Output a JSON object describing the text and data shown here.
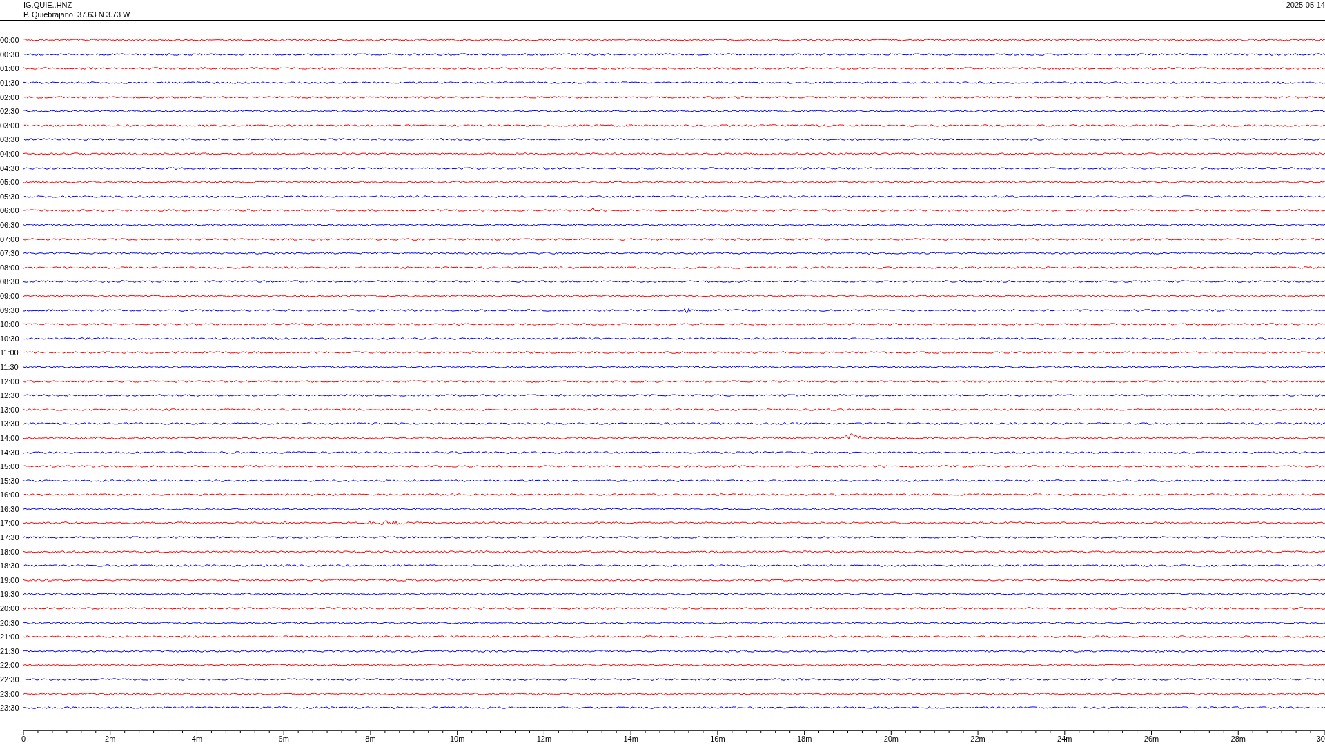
{
  "header": {
    "channel": "IG.QUIE..HNZ",
    "station": "P. Quiebrajano  37.63 N 3.73 W",
    "date": "2025-05-14"
  },
  "rows": [
    {
      "time": "00:00",
      "color": "#ff0000"
    },
    {
      "time": "00:30",
      "color": "#0000ff"
    },
    {
      "time": "01:00",
      "color": "#ff0000"
    },
    {
      "time": "01:30",
      "color": "#0000ff"
    },
    {
      "time": "02:00",
      "color": "#ff0000"
    },
    {
      "time": "02:30",
      "color": "#0000ff"
    },
    {
      "time": "03:00",
      "color": "#ff0000"
    },
    {
      "time": "03:30",
      "color": "#0000ff"
    },
    {
      "time": "04:00",
      "color": "#ff0000"
    },
    {
      "time": "04:30",
      "color": "#0000ff"
    },
    {
      "time": "05:00",
      "color": "#ff0000"
    },
    {
      "time": "05:30",
      "color": "#0000ff"
    },
    {
      "time": "06:00",
      "color": "#ff0000"
    },
    {
      "time": "06:30",
      "color": "#0000ff"
    },
    {
      "time": "07:00",
      "color": "#ff0000"
    },
    {
      "time": "07:30",
      "color": "#0000ff"
    },
    {
      "time": "08:00",
      "color": "#ff0000"
    },
    {
      "time": "08:30",
      "color": "#0000ff"
    },
    {
      "time": "09:00",
      "color": "#ff0000"
    },
    {
      "time": "09:30",
      "color": "#0000ff"
    },
    {
      "time": "10:00",
      "color": "#ff0000"
    },
    {
      "time": "10:30",
      "color": "#0000ff"
    },
    {
      "time": "11:00",
      "color": "#ff0000"
    },
    {
      "time": "11:30",
      "color": "#0000ff"
    },
    {
      "time": "12:00",
      "color": "#ff0000"
    },
    {
      "time": "12:30",
      "color": "#0000ff"
    },
    {
      "time": "13:00",
      "color": "#ff0000"
    },
    {
      "time": "13:30",
      "color": "#0000ff"
    },
    {
      "time": "14:00",
      "color": "#ff0000"
    },
    {
      "time": "14:30",
      "color": "#0000ff"
    },
    {
      "time": "15:00",
      "color": "#ff0000"
    },
    {
      "time": "15:30",
      "color": "#0000ff"
    },
    {
      "time": "16:00",
      "color": "#ff0000"
    },
    {
      "time": "16:30",
      "color": "#0000ff"
    },
    {
      "time": "17:00",
      "color": "#ff0000"
    },
    {
      "time": "17:30",
      "color": "#0000ff"
    },
    {
      "time": "18:00",
      "color": "#ff0000"
    },
    {
      "time": "18:30",
      "color": "#0000ff"
    },
    {
      "time": "19:00",
      "color": "#ff0000"
    },
    {
      "time": "19:30",
      "color": "#0000ff"
    },
    {
      "time": "20:00",
      "color": "#ff0000"
    },
    {
      "time": "20:30",
      "color": "#0000ff"
    },
    {
      "time": "21:00",
      "color": "#ff0000"
    },
    {
      "time": "21:30",
      "color": "#0000ff"
    },
    {
      "time": "22:00",
      "color": "#ff0000"
    },
    {
      "time": "22:30",
      "color": "#0000ff"
    },
    {
      "time": "23:00",
      "color": "#ff0000"
    },
    {
      "time": "23:30",
      "color": "#0000ff"
    }
  ],
  "axis": {
    "labels": [
      "0",
      "2m",
      "4m",
      "6m",
      "8m",
      "10m",
      "12m",
      "14m",
      "16m",
      "18m",
      "20m",
      "22m",
      "24m",
      "26m",
      "28m",
      "30"
    ]
  }
}
